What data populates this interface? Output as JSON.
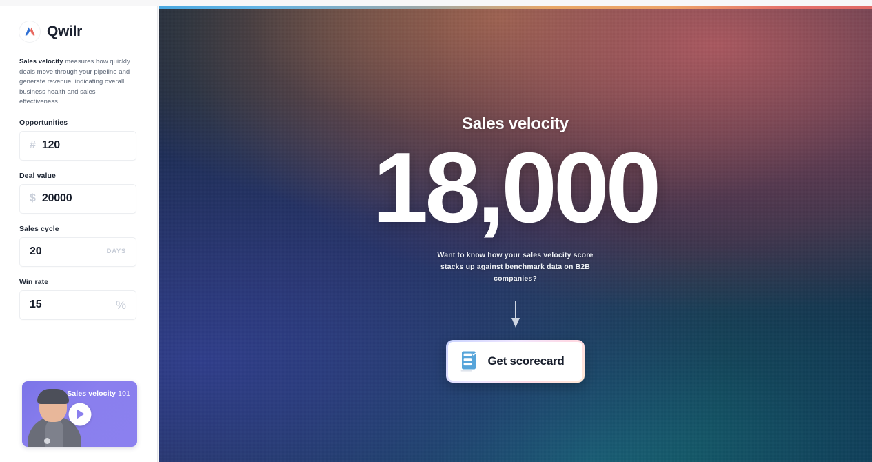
{
  "colors": {
    "brand_blue": "#2e6fd4",
    "brand_red": "#e8685f",
    "accent_purple": "#8a7fee",
    "cta_icon_blue": "#4b9fd8",
    "text_dark": "#161c29",
    "text_muted": "#5b6575"
  },
  "sidebar": {
    "brand": {
      "logo_icon": "qwilr-logo-icon",
      "name": "Qwilr"
    },
    "blurb": {
      "bold_lead": "Sales velocity",
      "rest": " measures how quickly deals move through your pipeline and generate revenue, indicating overall business health and sales effectiveness."
    },
    "fields": [
      {
        "label": "Opportunities",
        "prefix": "#",
        "value": "120",
        "suffix": "",
        "placeholder": "0"
      },
      {
        "label": "Deal value",
        "prefix": "$",
        "value": "20000",
        "suffix": "",
        "placeholder": "0"
      },
      {
        "label": "Sales cycle",
        "prefix": "",
        "value": "20",
        "suffix": "DAYS",
        "placeholder": "0"
      },
      {
        "label": "Win rate",
        "prefix": "",
        "value": "15",
        "suffix": "%",
        "placeholder": "0"
      }
    ],
    "video": {
      "title_main": "Sales velocity",
      "title_num": "101",
      "play_icon": "play-icon",
      "thumbnail_alt": "presenter-thumbnail"
    }
  },
  "hero": {
    "eyebrow": "Sales velocity",
    "number": "18,000",
    "subtext": "Want to know how your sales velocity score stacks up against benchmark data on B2B companies?",
    "arrow_icon": "arrow-down-icon",
    "cta": {
      "icon": "scorecard-icon",
      "label": "Get scorecard"
    }
  },
  "metrics": {
    "opportunities": 120,
    "deal_value": 20000,
    "sales_cycle_days": 20,
    "win_rate_percent": 15,
    "sales_velocity": 18000
  }
}
